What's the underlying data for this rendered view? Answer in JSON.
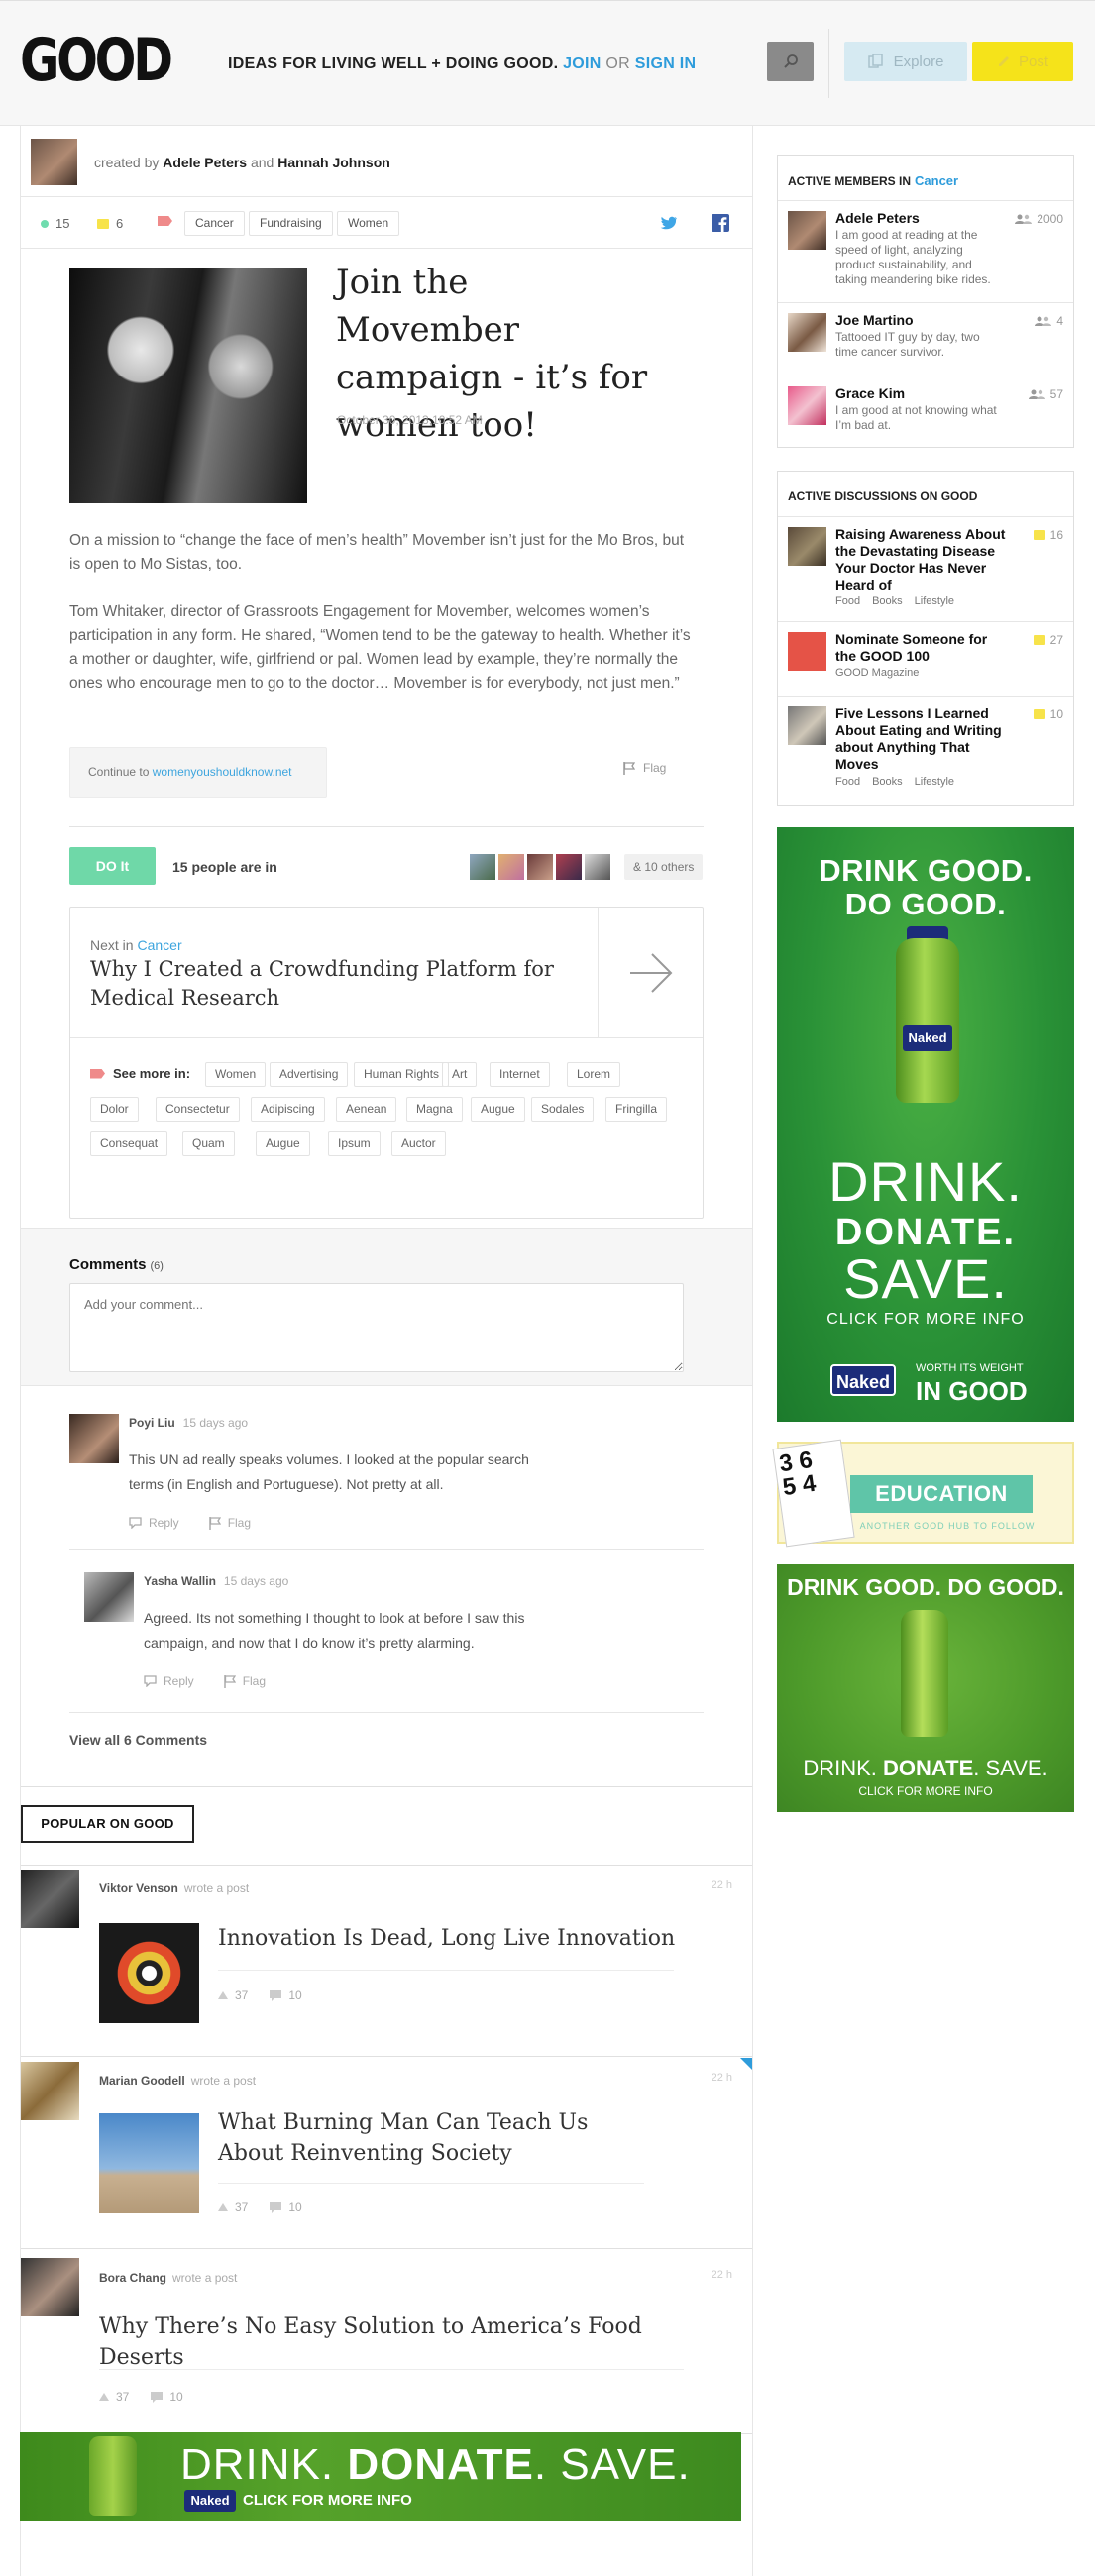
{
  "header": {
    "logo": "GOOD",
    "tagline": "IDEAS FOR LIVING WELL + DOING GOOD.",
    "join": "JOIN",
    "or": "OR",
    "signin": "SIGN IN",
    "explore_label": "Explore",
    "post_label": "Post",
    "colors": {
      "accent_blue": "#2e9cdb",
      "post_yellow": "#f5e31a",
      "explore_blue": "#d6eaf2"
    }
  },
  "created": {
    "prefix": "created by",
    "author1": "Adele Peters",
    "and": "and",
    "author2": "Hannah Johnson"
  },
  "meta": {
    "members_count": "15",
    "comments_count": "6",
    "tags": [
      "Cancer",
      "Fundraising",
      "Women"
    ]
  },
  "article": {
    "title": "Join the Movember campaign - it’s for women too!",
    "date": "October 30, 2013,10:52 AM",
    "paragraphs": [
      "On a mission to “change the face of men’s health” Movember isn’t just for the Mo Bros, but is open to Mo Sistas, too.",
      "Tom Whitaker, director of Grassroots Engagement for Movember, welcomes women’s participation in any form. He shared, “Women tend to be the gateway to health. Whether it’s a mother or daughter, wife, girlfriend or pal. Women lead by example, they’re normally the ones who encourage men to go to the doctor… Movember is for everybody, not just men.”"
    ],
    "continue_prefix": "Continue to",
    "continue_url": "womenyoushouldknow.net",
    "flag_label": "Flag"
  },
  "doit": {
    "button": "DO It",
    "people_in": "15 people are in",
    "others": "& 10 others"
  },
  "next": {
    "label": "Next in",
    "category": "Cancer",
    "title": "Why I Created a Crowdfunding Platform for Medical Research",
    "see_more": "See more in:",
    "chips": [
      "Women",
      "Advertising",
      "Human Rights",
      "Art",
      "Internet",
      "Lorem",
      "Dolor",
      "Consectetur",
      "Adipiscing",
      "Aenean",
      "Magna",
      "Augue",
      "Sodales",
      "Fringilla",
      "Consequat",
      "Quam",
      "Augue",
      "Ipsum",
      "Auctor"
    ]
  },
  "comments": {
    "title": "Comments",
    "count": "(6)",
    "placeholder": "Add your comment...",
    "items": [
      {
        "author": "Poyi Liu",
        "ago": "15 days ago",
        "text": "This UN ad really speaks volumes. I looked at the popular search terms (in English and Portuguese). Not pretty at all.",
        "reply": "Reply",
        "flag": "Flag"
      },
      {
        "author": "Yasha Wallin",
        "ago": "15 days ago",
        "text": "Agreed. Its not something I thought to look at before I saw this campaign, and now that I do know it’s pretty alarming.",
        "reply": "Reply",
        "flag": "Flag"
      }
    ],
    "view_all": "View all 6 Comments"
  },
  "popular": {
    "heading": "POPULAR ON GOOD",
    "items": [
      {
        "author": "Viktor Venson",
        "verb": "wrote a post",
        "time": "22 h",
        "title": "Innovation Is Dead, Long Live Innovation",
        "likes": "37",
        "comments": "10"
      },
      {
        "author": "Marian Goodell",
        "verb": "wrote a post",
        "time": "22 h",
        "title": "What Burning Man Can Teach Us About Reinventing Society",
        "likes": "37",
        "comments": "10"
      },
      {
        "author": "Bora Chang",
        "verb": "wrote a post",
        "time": "22 h",
        "title": "Why There’s No Easy Solution to America’s Food Deserts",
        "likes": "37",
        "comments": "10"
      }
    ]
  },
  "sidebar": {
    "members": {
      "heading": "ACTIVE MEMBERS IN",
      "category": "Cancer",
      "items": [
        {
          "name": "Adele Peters",
          "desc": "I am good at reading at the speed of light, analyzing product sustainability, and taking meandering bike rides.",
          "count": "2000"
        },
        {
          "name": "Joe Martino",
          "desc": "Tattooed IT guy by day, two time cancer survivor.",
          "count": "4"
        },
        {
          "name": "Grace Kim",
          "desc": "I am good at not knowing what I’m bad at.",
          "count": "57"
        }
      ]
    },
    "discussions": {
      "heading": "ACTIVE DISCUSSIONS ON GOOD",
      "items": [
        {
          "title": "Raising Awareness About the Devastating Disease Your Doctor Has Never Heard of",
          "count": "16",
          "tags": [
            "Food",
            "Books",
            "Lifestyle"
          ]
        },
        {
          "title": "Nominate Someone for the GOOD 100",
          "count": "27",
          "sub": "GOOD Magazine"
        },
        {
          "title": "Five Lessons I Learned About Eating and Writing about Anything That Moves",
          "count": "10",
          "tags": [
            "Food",
            "Books",
            "Lifestyle"
          ]
        }
      ]
    },
    "ad_tall": {
      "line1": "DRINK GOOD.",
      "line2": "DO GOOD.",
      "drink": "DRINK.",
      "donate": "DONATE.",
      "save": "SAVE.",
      "click": "CLICK FOR MORE INFO",
      "brand": "Naked",
      "worth1": "WORTH ITS WEIGHT",
      "worth2": "IN GOOD"
    },
    "education": {
      "title": "EDUCATION",
      "sub": "ANOTHER GOOD HUB TO FOLLOW"
    },
    "ad_square": {
      "headline": "DRINK GOOD. DO GOOD.",
      "line2a": "DRINK.",
      "line2b": "DONATE",
      "line2c": ". SAVE.",
      "click": "CLICK FOR MORE INFO"
    }
  },
  "banner_bottom": {
    "drink": "DRINK. ",
    "donate": "DONATE",
    "save": ". SAVE.",
    "brand": "Naked",
    "click": "CLICK FOR MORE INFO"
  }
}
